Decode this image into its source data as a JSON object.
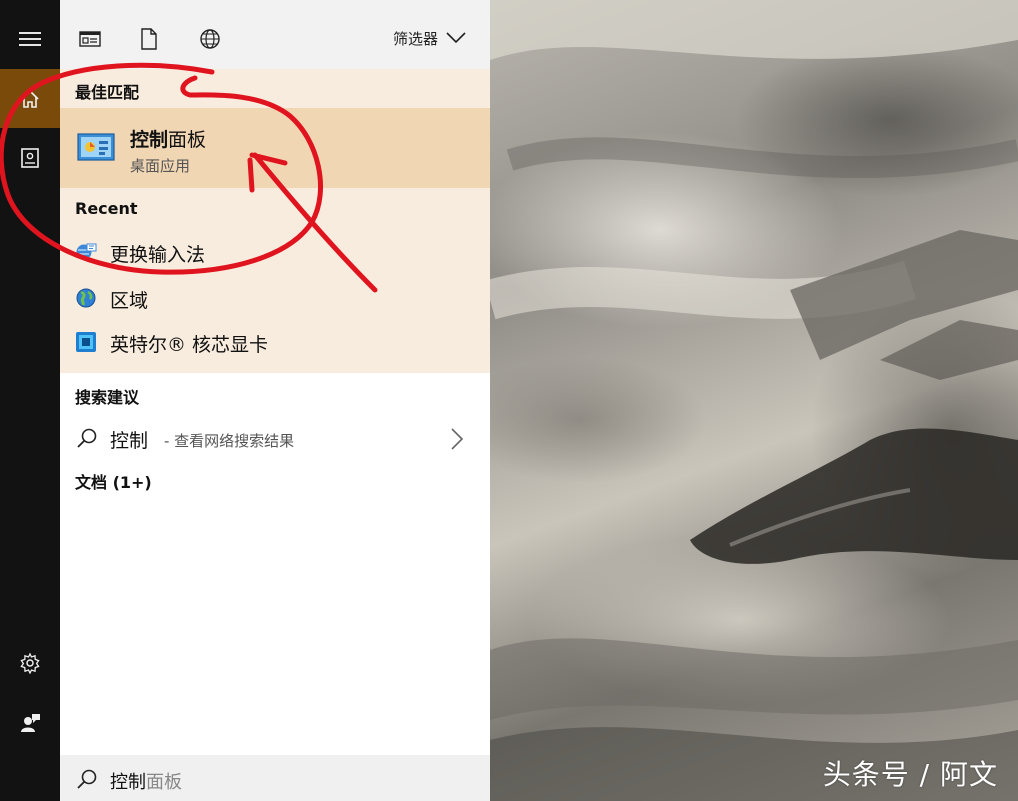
{
  "rail": {
    "items": [
      {
        "name": "menu",
        "icon": "hamburger-icon"
      },
      {
        "name": "home",
        "icon": "home-icon",
        "active": true
      },
      {
        "name": "notebook",
        "icon": "notebook-icon"
      },
      {
        "name": "settings",
        "icon": "gear-icon"
      },
      {
        "name": "feedback",
        "icon": "feedback-icon"
      }
    ],
    "active_color": "#7a4a0a"
  },
  "top_bar": {
    "filter_label": "筛选器",
    "icons": [
      "apps-filter-icon",
      "documents-filter-icon",
      "web-filter-icon"
    ]
  },
  "best_match": {
    "section_label": "最佳匹配",
    "title_bold": "控制",
    "title_rest": "面板",
    "subtitle": "桌面应用",
    "icon": "control-panel-icon"
  },
  "recent": {
    "section_label": "Recent",
    "items": [
      {
        "label": "更换输入法",
        "icon": "language-icon"
      },
      {
        "label": "区域",
        "icon": "region-globe-icon"
      },
      {
        "label": "英特尔® 核芯显卡",
        "icon": "intel-graphics-icon"
      }
    ]
  },
  "suggestions": {
    "section_label": "搜索建议",
    "term": "控制",
    "hint": "- 查看网络搜索结果"
  },
  "documents": {
    "section_label": "文档 (1+)"
  },
  "search_box": {
    "typed": "控制",
    "autocomplete": "面板"
  },
  "watermark": "头条号 / 阿文",
  "colors": {
    "highlight_bg": "#f8ecde",
    "selected_bg": "#f1d6b4",
    "annotation_red": "#e0141e"
  }
}
